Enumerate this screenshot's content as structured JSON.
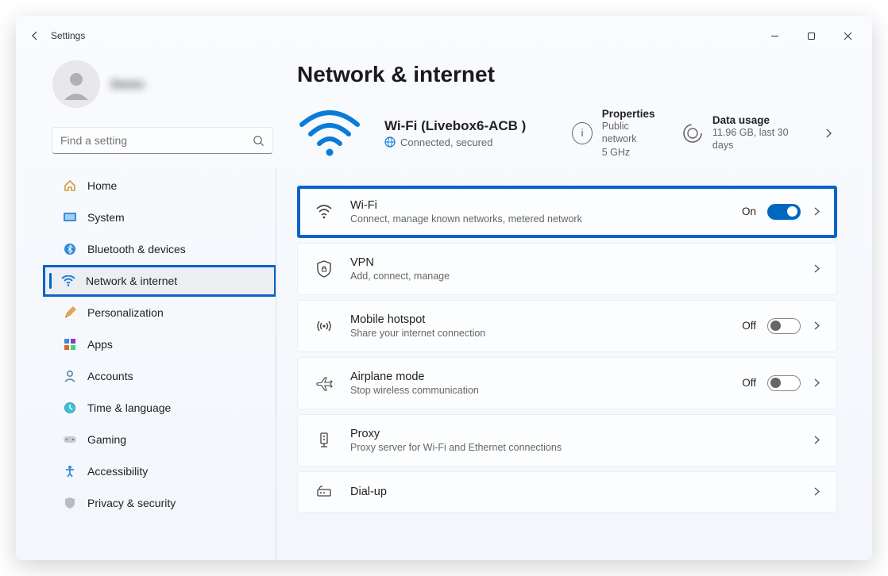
{
  "window": {
    "title": "Settings"
  },
  "search": {
    "placeholder": "Find a setting"
  },
  "sidebar": {
    "items": [
      {
        "label": "Home"
      },
      {
        "label": "System"
      },
      {
        "label": "Bluetooth & devices"
      },
      {
        "label": "Network & internet"
      },
      {
        "label": "Personalization"
      },
      {
        "label": "Apps"
      },
      {
        "label": "Accounts"
      },
      {
        "label": "Time & language"
      },
      {
        "label": "Gaming"
      },
      {
        "label": "Accessibility"
      },
      {
        "label": "Privacy & security"
      }
    ]
  },
  "page": {
    "title": "Network & internet",
    "status": {
      "ssid": "Wi-Fi (Livebox6-ACB   )",
      "connection": "Connected, secured",
      "properties": {
        "label": "Properties",
        "line1": "Public network",
        "line2": "5 GHz"
      },
      "usage": {
        "label": "Data usage",
        "value": "11.96 GB, last 30 days"
      }
    },
    "items": [
      {
        "title": "Wi-Fi",
        "desc": "Connect, manage known networks, metered network",
        "state": "On",
        "toggle": true
      },
      {
        "title": "VPN",
        "desc": "Add, connect, manage"
      },
      {
        "title": "Mobile hotspot",
        "desc": "Share your internet connection",
        "state": "Off",
        "toggle": false
      },
      {
        "title": "Airplane mode",
        "desc": "Stop wireless communication",
        "state": "Off",
        "toggle": false
      },
      {
        "title": "Proxy",
        "desc": "Proxy server for Wi-Fi and Ethernet connections"
      },
      {
        "title": "Dial-up",
        "desc": ""
      }
    ]
  }
}
